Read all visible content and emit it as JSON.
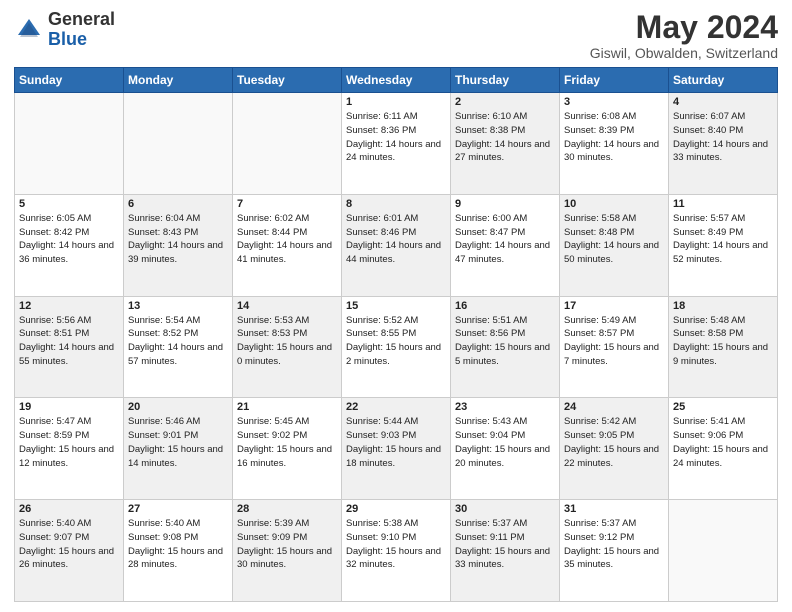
{
  "header": {
    "logo_general": "General",
    "logo_blue": "Blue",
    "month_year": "May 2024",
    "location": "Giswil, Obwalden, Switzerland"
  },
  "days_of_week": [
    "Sunday",
    "Monday",
    "Tuesday",
    "Wednesday",
    "Thursday",
    "Friday",
    "Saturday"
  ],
  "weeks": [
    [
      {
        "day": "",
        "info": "",
        "shaded": false,
        "empty": true
      },
      {
        "day": "",
        "info": "",
        "shaded": false,
        "empty": true
      },
      {
        "day": "",
        "info": "",
        "shaded": false,
        "empty": true
      },
      {
        "day": "1",
        "info": "Sunrise: 6:11 AM\nSunset: 8:36 PM\nDaylight: 14 hours and 24 minutes.",
        "shaded": false,
        "empty": false
      },
      {
        "day": "2",
        "info": "Sunrise: 6:10 AM\nSunset: 8:38 PM\nDaylight: 14 hours and 27 minutes.",
        "shaded": true,
        "empty": false
      },
      {
        "day": "3",
        "info": "Sunrise: 6:08 AM\nSunset: 8:39 PM\nDaylight: 14 hours and 30 minutes.",
        "shaded": false,
        "empty": false
      },
      {
        "day": "4",
        "info": "Sunrise: 6:07 AM\nSunset: 8:40 PM\nDaylight: 14 hours and 33 minutes.",
        "shaded": true,
        "empty": false
      }
    ],
    [
      {
        "day": "5",
        "info": "Sunrise: 6:05 AM\nSunset: 8:42 PM\nDaylight: 14 hours and 36 minutes.",
        "shaded": false,
        "empty": false
      },
      {
        "day": "6",
        "info": "Sunrise: 6:04 AM\nSunset: 8:43 PM\nDaylight: 14 hours and 39 minutes.",
        "shaded": true,
        "empty": false
      },
      {
        "day": "7",
        "info": "Sunrise: 6:02 AM\nSunset: 8:44 PM\nDaylight: 14 hours and 41 minutes.",
        "shaded": false,
        "empty": false
      },
      {
        "day": "8",
        "info": "Sunrise: 6:01 AM\nSunset: 8:46 PM\nDaylight: 14 hours and 44 minutes.",
        "shaded": true,
        "empty": false
      },
      {
        "day": "9",
        "info": "Sunrise: 6:00 AM\nSunset: 8:47 PM\nDaylight: 14 hours and 47 minutes.",
        "shaded": false,
        "empty": false
      },
      {
        "day": "10",
        "info": "Sunrise: 5:58 AM\nSunset: 8:48 PM\nDaylight: 14 hours and 50 minutes.",
        "shaded": true,
        "empty": false
      },
      {
        "day": "11",
        "info": "Sunrise: 5:57 AM\nSunset: 8:49 PM\nDaylight: 14 hours and 52 minutes.",
        "shaded": false,
        "empty": false
      }
    ],
    [
      {
        "day": "12",
        "info": "Sunrise: 5:56 AM\nSunset: 8:51 PM\nDaylight: 14 hours and 55 minutes.",
        "shaded": true,
        "empty": false
      },
      {
        "day": "13",
        "info": "Sunrise: 5:54 AM\nSunset: 8:52 PM\nDaylight: 14 hours and 57 minutes.",
        "shaded": false,
        "empty": false
      },
      {
        "day": "14",
        "info": "Sunrise: 5:53 AM\nSunset: 8:53 PM\nDaylight: 15 hours and 0 minutes.",
        "shaded": true,
        "empty": false
      },
      {
        "day": "15",
        "info": "Sunrise: 5:52 AM\nSunset: 8:55 PM\nDaylight: 15 hours and 2 minutes.",
        "shaded": false,
        "empty": false
      },
      {
        "day": "16",
        "info": "Sunrise: 5:51 AM\nSunset: 8:56 PM\nDaylight: 15 hours and 5 minutes.",
        "shaded": true,
        "empty": false
      },
      {
        "day": "17",
        "info": "Sunrise: 5:49 AM\nSunset: 8:57 PM\nDaylight: 15 hours and 7 minutes.",
        "shaded": false,
        "empty": false
      },
      {
        "day": "18",
        "info": "Sunrise: 5:48 AM\nSunset: 8:58 PM\nDaylight: 15 hours and 9 minutes.",
        "shaded": true,
        "empty": false
      }
    ],
    [
      {
        "day": "19",
        "info": "Sunrise: 5:47 AM\nSunset: 8:59 PM\nDaylight: 15 hours and 12 minutes.",
        "shaded": false,
        "empty": false
      },
      {
        "day": "20",
        "info": "Sunrise: 5:46 AM\nSunset: 9:01 PM\nDaylight: 15 hours and 14 minutes.",
        "shaded": true,
        "empty": false
      },
      {
        "day": "21",
        "info": "Sunrise: 5:45 AM\nSunset: 9:02 PM\nDaylight: 15 hours and 16 minutes.",
        "shaded": false,
        "empty": false
      },
      {
        "day": "22",
        "info": "Sunrise: 5:44 AM\nSunset: 9:03 PM\nDaylight: 15 hours and 18 minutes.",
        "shaded": true,
        "empty": false
      },
      {
        "day": "23",
        "info": "Sunrise: 5:43 AM\nSunset: 9:04 PM\nDaylight: 15 hours and 20 minutes.",
        "shaded": false,
        "empty": false
      },
      {
        "day": "24",
        "info": "Sunrise: 5:42 AM\nSunset: 9:05 PM\nDaylight: 15 hours and 22 minutes.",
        "shaded": true,
        "empty": false
      },
      {
        "day": "25",
        "info": "Sunrise: 5:41 AM\nSunset: 9:06 PM\nDaylight: 15 hours and 24 minutes.",
        "shaded": false,
        "empty": false
      }
    ],
    [
      {
        "day": "26",
        "info": "Sunrise: 5:40 AM\nSunset: 9:07 PM\nDaylight: 15 hours and 26 minutes.",
        "shaded": true,
        "empty": false
      },
      {
        "day": "27",
        "info": "Sunrise: 5:40 AM\nSunset: 9:08 PM\nDaylight: 15 hours and 28 minutes.",
        "shaded": false,
        "empty": false
      },
      {
        "day": "28",
        "info": "Sunrise: 5:39 AM\nSunset: 9:09 PM\nDaylight: 15 hours and 30 minutes.",
        "shaded": true,
        "empty": false
      },
      {
        "day": "29",
        "info": "Sunrise: 5:38 AM\nSunset: 9:10 PM\nDaylight: 15 hours and 32 minutes.",
        "shaded": false,
        "empty": false
      },
      {
        "day": "30",
        "info": "Sunrise: 5:37 AM\nSunset: 9:11 PM\nDaylight: 15 hours and 33 minutes.",
        "shaded": true,
        "empty": false
      },
      {
        "day": "31",
        "info": "Sunrise: 5:37 AM\nSunset: 9:12 PM\nDaylight: 15 hours and 35 minutes.",
        "shaded": false,
        "empty": false
      },
      {
        "day": "",
        "info": "",
        "shaded": false,
        "empty": true
      }
    ]
  ]
}
